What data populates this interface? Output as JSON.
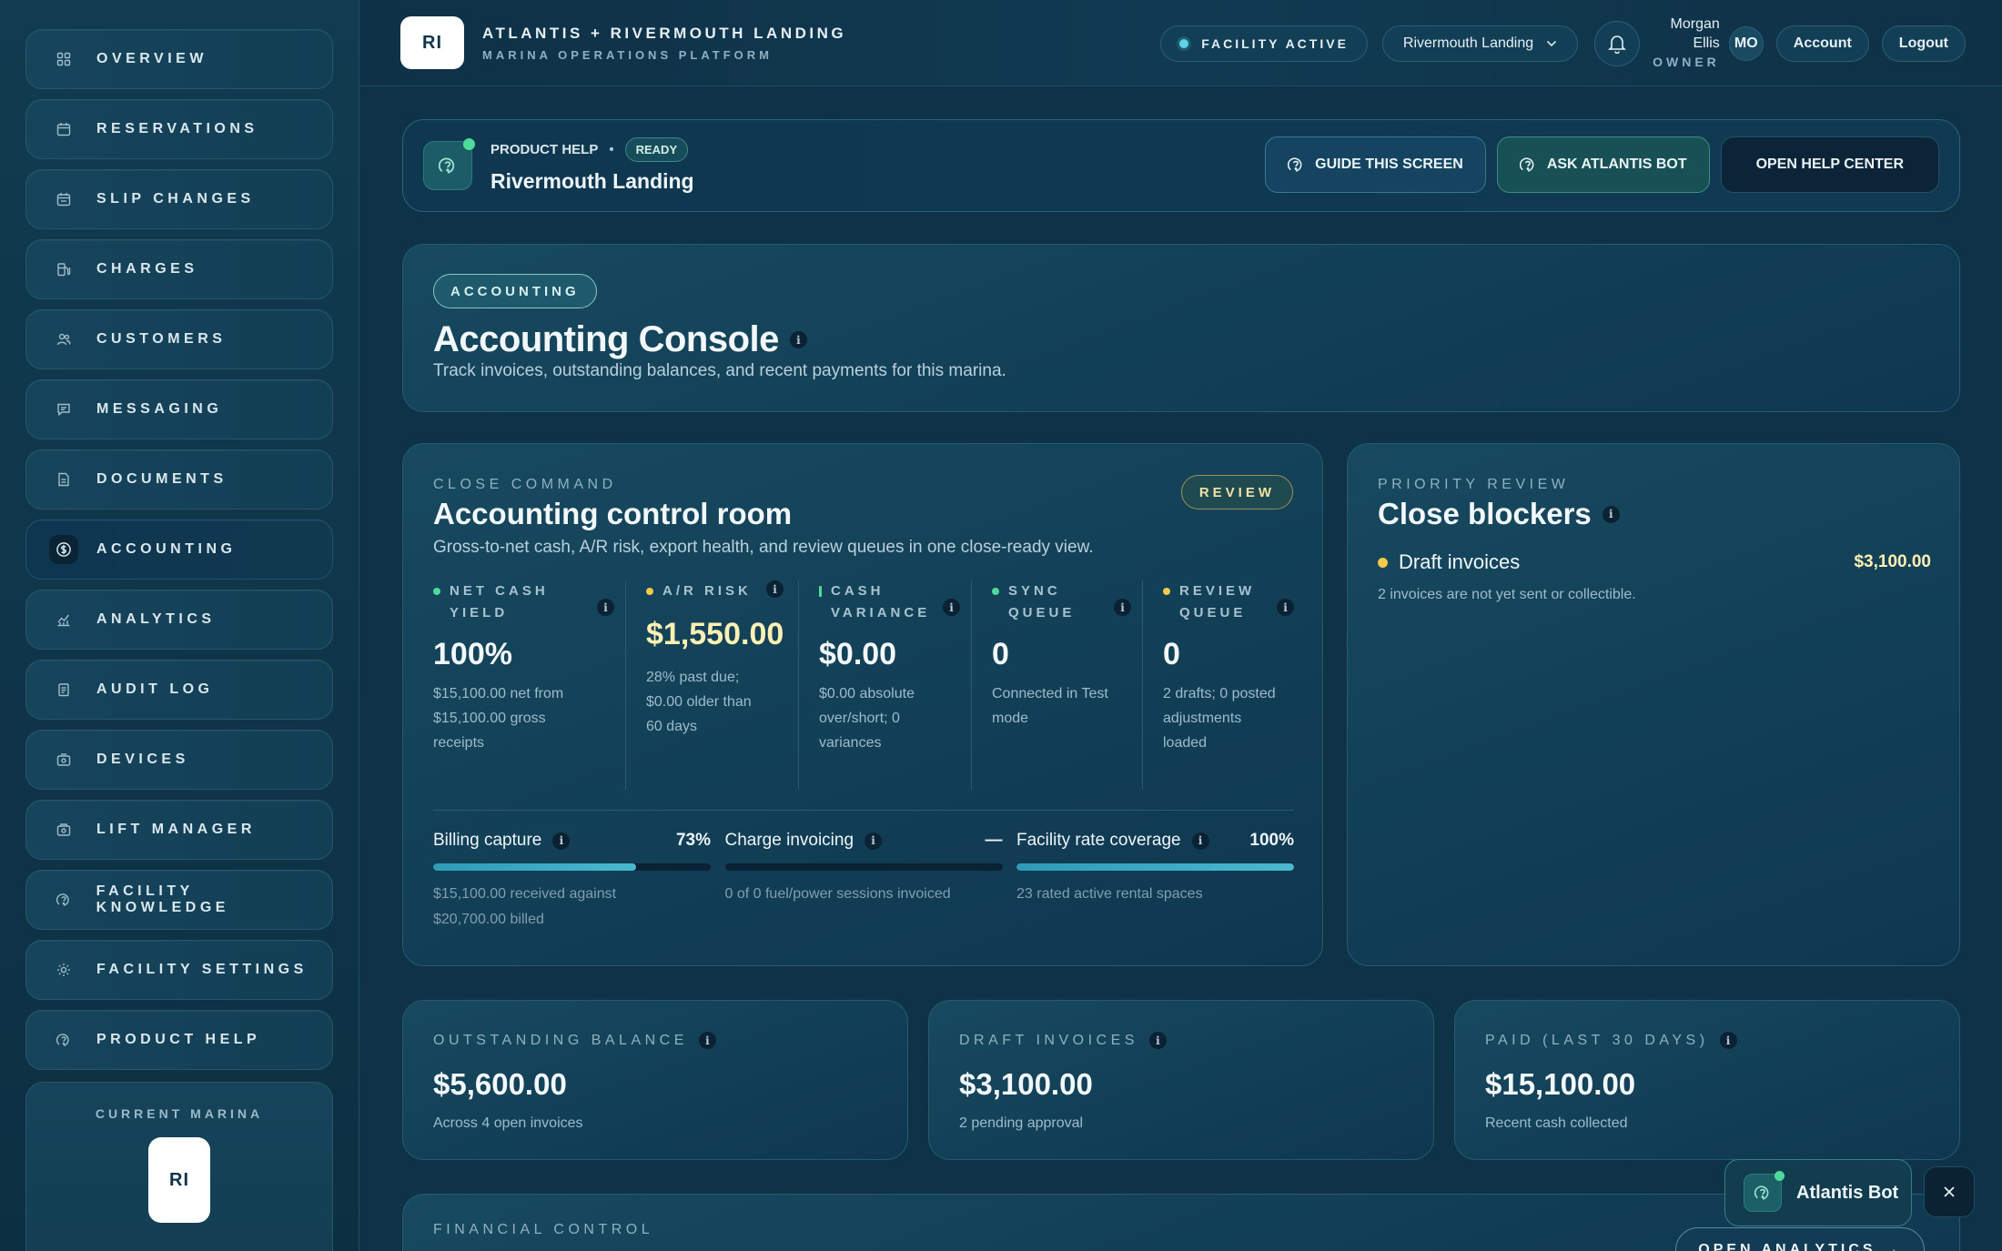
{
  "brand": {
    "logo": "RI",
    "title": "ATLANTIS + RIVERMOUTH LANDING",
    "subtitle": "MARINA OPERATIONS PLATFORM"
  },
  "header": {
    "status": "FACILITY ACTIVE",
    "marina_select": "Rivermouth Landing",
    "user_first": "Morgan",
    "user_last": "Ellis",
    "user_role": "OWNER",
    "avatar": "MO",
    "account": "Account",
    "logout": "Logout"
  },
  "sidebar": {
    "items": [
      {
        "label": "OVERVIEW",
        "icon": "grid-icon"
      },
      {
        "label": "RESERVATIONS",
        "icon": "calendar-icon"
      },
      {
        "label": "SLIP CHANGES",
        "icon": "calendar-swap-icon"
      },
      {
        "label": "CHARGES",
        "icon": "fuel-pump-icon"
      },
      {
        "label": "CUSTOMERS",
        "icon": "users-icon"
      },
      {
        "label": "MESSAGING",
        "icon": "chat-icon"
      },
      {
        "label": "DOCUMENTS",
        "icon": "document-icon"
      },
      {
        "label": "ACCOUNTING",
        "icon": "dollar-circle-icon"
      },
      {
        "label": "ANALYTICS",
        "icon": "chart-icon"
      },
      {
        "label": "AUDIT LOG",
        "icon": "clipboard-icon"
      },
      {
        "label": "DEVICES",
        "icon": "device-icon"
      },
      {
        "label": "LIFT MANAGER",
        "icon": "lift-icon"
      },
      {
        "label": "FACILITY KNOWLEDGE",
        "icon": "help-circle-icon"
      },
      {
        "label": "FACILITY SETTINGS",
        "icon": "gear-icon"
      },
      {
        "label": "PRODUCT HELP",
        "icon": "help-circle-icon"
      }
    ],
    "current_marina_label": "CURRENT MARINA",
    "current_marina_logo": "RI"
  },
  "help_bar": {
    "label": "PRODUCT HELP",
    "badge": "READY",
    "title": "Rivermouth Landing",
    "guide": "GUIDE THIS SCREEN",
    "ask": "ASK ATLANTIS BOT",
    "open": "OPEN HELP CENTER"
  },
  "hero": {
    "chip": "ACCOUNTING",
    "title": "Accounting Console",
    "description": "Track invoices, outstanding balances, and recent payments for this marina."
  },
  "close_command": {
    "eyebrow": "CLOSE COMMAND",
    "badge": "REVIEW",
    "title": "Accounting control room",
    "subtitle": "Gross-to-net cash, A/R risk, export health, and review queues in one close-ready view.",
    "metrics": [
      {
        "label_1": "NET CASH",
        "label_2": "YIELD",
        "value": "100%",
        "note_1": "$15,100.00 net from",
        "note_2": "$15,100.00 gross",
        "note_3": "receipts",
        "dot": "#4ddb9a"
      },
      {
        "label_1": "A/R RISK",
        "label_2": "",
        "value": "$1,550.00",
        "note_1": "28% past due;",
        "note_2": "$0.00 older than",
        "note_3": "60 days",
        "dot": "#f6c94a"
      },
      {
        "label_1": "CASH",
        "label_2": "VARIANCE",
        "value": "$0.00",
        "note_1": "$0.00 absolute",
        "note_2": "over/short; 0",
        "note_3": "variances",
        "dot": "#4ddb9a"
      },
      {
        "label_1": "SYNC",
        "label_2": "QUEUE",
        "value": "0",
        "note_1": "Connected in Test",
        "note_2": "mode",
        "note_3": "",
        "dot": "#4ddb9a"
      },
      {
        "label_1": "REVIEW",
        "label_2": "QUEUE",
        "value": "0",
        "note_1": "2 drafts; 0 posted",
        "note_2": "adjustments",
        "note_3": "loaded",
        "dot": "#f6c94a"
      }
    ],
    "bars": [
      {
        "name": "Billing capture",
        "pct": "73%",
        "fill": 0.73,
        "note_1": "$15,100.00 received against",
        "note_2": "$20,700.00 billed"
      },
      {
        "name": "Charge invoicing",
        "pct": "—",
        "fill": 0,
        "note_1": "0 of 0 fuel/power sessions invoiced",
        "note_2": ""
      },
      {
        "name": "Facility rate coverage",
        "pct": "100%",
        "fill": 1.0,
        "note_1": "23 rated active rental spaces",
        "note_2": ""
      }
    ]
  },
  "blockers": {
    "eyebrow": "PRIORITY REVIEW",
    "title": "Close blockers",
    "item_name": "Draft invoices",
    "item_amount": "$3,100.00",
    "item_note": "2 invoices are not yet sent or collectible."
  },
  "stats": [
    {
      "label": "OUTSTANDING BALANCE",
      "value": "$5,600.00",
      "note": "Across 4 open invoices"
    },
    {
      "label": "DRAFT INVOICES",
      "value": "$3,100.00",
      "note": "2 pending approval"
    },
    {
      "label": "PAID (LAST 30 DAYS)",
      "value": "$15,100.00",
      "note": "Recent cash collected"
    }
  ],
  "financial": {
    "eyebrow": "FINANCIAL CONTROL",
    "button": "OPEN ANALYTICS →"
  },
  "bot": {
    "label": "Atlantis Bot"
  },
  "info": "i"
}
